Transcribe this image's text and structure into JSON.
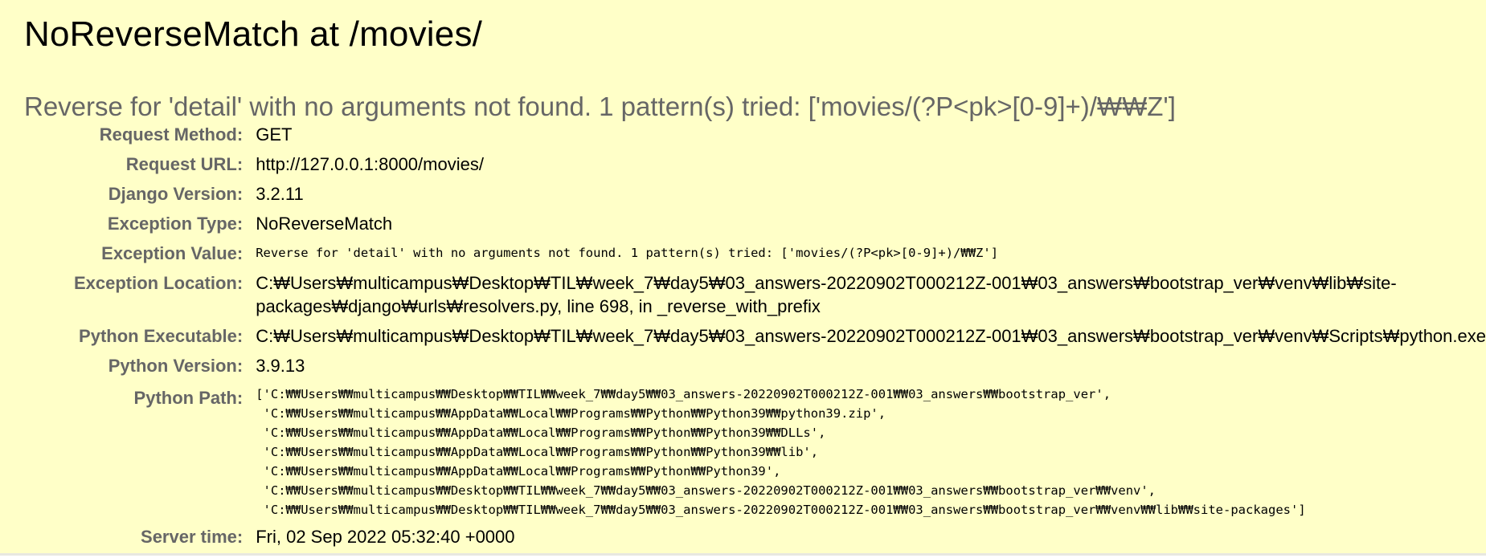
{
  "title": "NoReverseMatch at /movies/",
  "subtitle": "Reverse for 'detail' with no arguments not found. 1 pattern(s) tried: ['movies/(?P<pk>[0-9]+)/₩₩Z']",
  "meta": {
    "request_method": {
      "label": "Request Method:",
      "value": "GET"
    },
    "request_url": {
      "label": "Request URL:",
      "value": "http://127.0.0.1:8000/movies/"
    },
    "django_version": {
      "label": "Django Version:",
      "value": "3.2.11"
    },
    "exception_type": {
      "label": "Exception Type:",
      "value": "NoReverseMatch"
    },
    "exception_value": {
      "label": "Exception Value:",
      "value": "Reverse for 'detail' with no arguments not found. 1 pattern(s) tried: ['movies/(?P<pk>[0-9]+)/₩₩Z']"
    },
    "exception_location": {
      "label": "Exception Location:",
      "value": "C:₩Users₩multicampus₩Desktop₩TIL₩week_7₩day5₩03_answers-20220902T000212Z-001₩03_answers₩bootstrap_ver₩venv₩lib₩site-packages₩django₩urls₩resolvers.py, line 698, in _reverse_with_prefix"
    },
    "python_executable": {
      "label": "Python Executable:",
      "value": "C:₩Users₩multicampus₩Desktop₩TIL₩week_7₩day5₩03_answers-20220902T000212Z-001₩03_answers₩bootstrap_ver₩venv₩Scripts₩python.exe"
    },
    "python_version": {
      "label": "Python Version:",
      "value": "3.9.13"
    },
    "python_path": {
      "label": "Python Path:",
      "lines": [
        "['C:₩₩Users₩₩multicampus₩₩Desktop₩₩TIL₩₩week_7₩₩day5₩₩03_answers-20220902T000212Z-001₩₩03_answers₩₩bootstrap_ver',",
        " 'C:₩₩Users₩₩multicampus₩₩AppData₩₩Local₩₩Programs₩₩Python₩₩Python39₩₩python39.zip',",
        " 'C:₩₩Users₩₩multicampus₩₩AppData₩₩Local₩₩Programs₩₩Python₩₩Python39₩₩DLLs',",
        " 'C:₩₩Users₩₩multicampus₩₩AppData₩₩Local₩₩Programs₩₩Python₩₩Python39₩₩lib',",
        " 'C:₩₩Users₩₩multicampus₩₩AppData₩₩Local₩₩Programs₩₩Python₩₩Python39',",
        " 'C:₩₩Users₩₩multicampus₩₩Desktop₩₩TIL₩₩week_7₩₩day5₩₩03_answers-20220902T000212Z-001₩₩03_answers₩₩bootstrap_ver₩₩venv',",
        " 'C:₩₩Users₩₩multicampus₩₩Desktop₩₩TIL₩₩week_7₩₩day5₩₩03_answers-20220902T000212Z-001₩₩03_answers₩₩bootstrap_ver₩₩venv₩₩lib₩₩site-packages']"
      ]
    },
    "server_time": {
      "label": "Server time:",
      "value": "Fri, 02 Sep 2022 05:32:40 +0000"
    }
  },
  "colors": {
    "summary_background": "#ffffc8",
    "label_text": "#666666",
    "subtitle_text": "#666666"
  }
}
